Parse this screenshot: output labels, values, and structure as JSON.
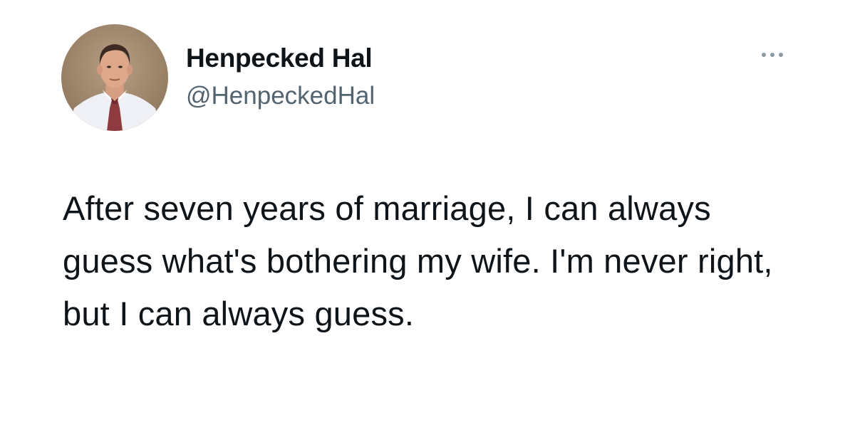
{
  "tweet": {
    "author": {
      "display_name": "Henpecked Hal",
      "handle": "@HenpeckedHal",
      "avatar_icon": "profile-photo"
    },
    "menu_icon": "more-options-icon",
    "text": "After seven years of marriage, I can always guess what's bothering my wife. I'm never right, but I can always guess."
  },
  "colors": {
    "background": "#ffffff",
    "text_primary": "#0f1419",
    "text_secondary": "#536471"
  }
}
